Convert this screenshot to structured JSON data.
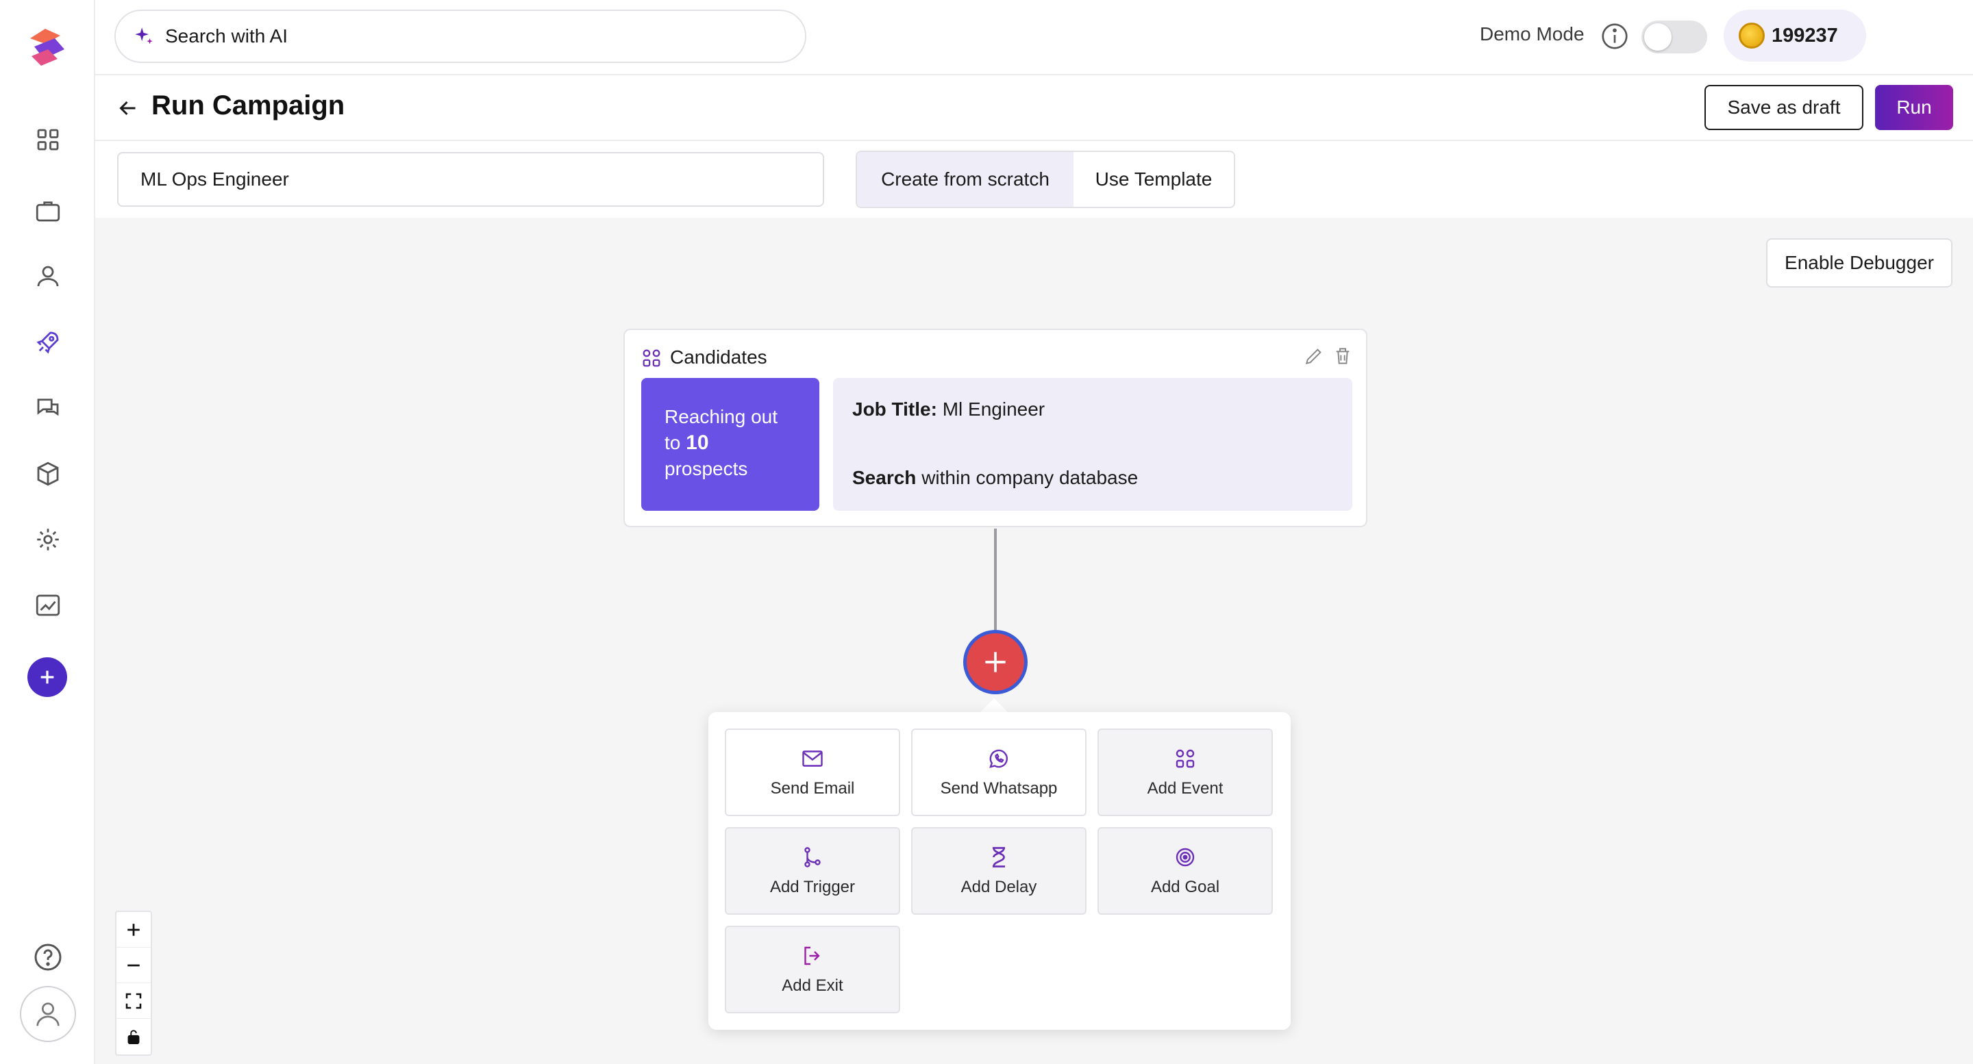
{
  "topbar": {
    "search_placeholder": "Search with AI",
    "demo_mode_label": "Demo Mode",
    "demo_mode_on": false,
    "credits": "199237"
  },
  "header": {
    "title": "Run Campaign",
    "save_draft_label": "Save as draft",
    "run_label": "Run"
  },
  "campaign": {
    "name_value": "ML Ops Engineer",
    "mode_options": [
      "Create from scratch",
      "Use Template"
    ],
    "selected_mode": "Create from scratch"
  },
  "canvas": {
    "debugger_label": "Enable Debugger",
    "node": {
      "title": "Candidates",
      "reach_prefix": "Reaching out to",
      "reach_count": "10",
      "reach_suffix": "prospects",
      "job_title_label": "Job Title:",
      "job_title_value": "Ml Engineer",
      "search_label": "Search",
      "search_value": "within company database"
    },
    "actions": [
      {
        "label": "Send Email",
        "icon": "mail-icon"
      },
      {
        "label": "Send Whatsapp",
        "icon": "whatsapp-icon"
      },
      {
        "label": "Add Event",
        "icon": "grid-people-icon"
      },
      {
        "label": "Add Trigger",
        "icon": "branch-icon"
      },
      {
        "label": "Add Delay",
        "icon": "hourglass-icon"
      },
      {
        "label": "Add Goal",
        "icon": "target-icon"
      },
      {
        "label": "Add Exit",
        "icon": "exit-icon"
      }
    ]
  },
  "sidebar": {
    "items": [
      "dashboard-icon",
      "briefcase-icon",
      "person-icon",
      "rocket-icon",
      "chat-icon",
      "cube-icon",
      "gear-icon",
      "chart-icon"
    ]
  },
  "colors": {
    "accent": "#4b2bc4",
    "run_gradient_start": "#5b21b6",
    "run_gradient_end": "#9b1fa8",
    "reach_box": "#6951e6",
    "add_step": "#e0474a"
  }
}
